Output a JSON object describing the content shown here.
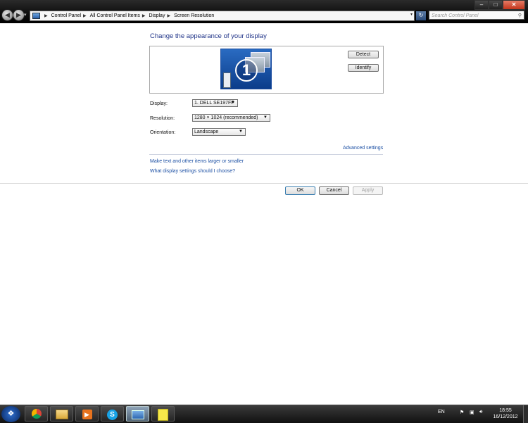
{
  "window": {
    "controls": {
      "minimize": "–",
      "maximize": "□",
      "close": "✕"
    }
  },
  "address": {
    "crumbs": [
      "Control Panel",
      "All Control Panel Items",
      "Display",
      "Screen Resolution"
    ],
    "search_placeholder": "Search Control Panel"
  },
  "main": {
    "heading": "Change the appearance of your display",
    "detect_label": "Detect",
    "identify_label": "Identify",
    "monitor_number": "1",
    "display_label": "Display:",
    "display_value": "1. DELL SE197FP",
    "resolution_label": "Resolution:",
    "resolution_value": "1280 × 1024 (recommended)",
    "orientation_label": "Orientation:",
    "orientation_value": "Landscape",
    "advanced_link": "Advanced settings",
    "larger_link": "Make text and other items larger or smaller",
    "which_link": "What display settings should I choose?"
  },
  "dialog": {
    "ok": "OK",
    "cancel": "Cancel",
    "apply": "Apply"
  },
  "taskbar": {
    "items": [
      {
        "icon": "chrome-icon"
      },
      {
        "icon": "file-explorer-icon"
      },
      {
        "icon": "media-player-icon"
      },
      {
        "icon": "skype-icon"
      },
      {
        "icon": "screen-resolution-icon"
      },
      {
        "icon": "sticky-notes-icon"
      }
    ],
    "language": "EN",
    "time": "18:55",
    "date": "16/12/2012"
  },
  "colors": {
    "heading": "#1e3287",
    "link": "#1a4ea3",
    "monitor": "#1e5fb4"
  }
}
